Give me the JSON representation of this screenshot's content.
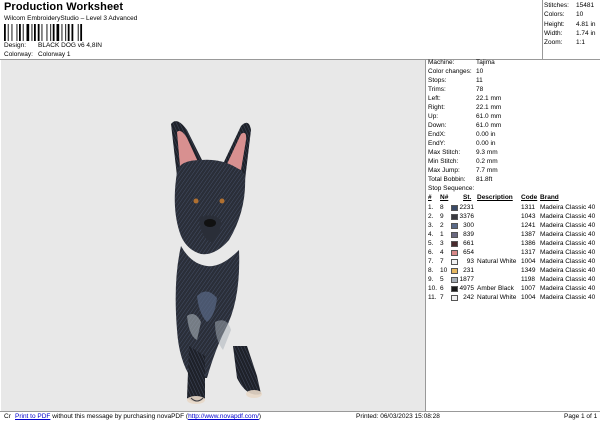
{
  "header": {
    "title": "Production Worksheet",
    "subtitle": "Wilcom EmbroideryStudio – Level 3 Advanced",
    "design_label": "Design:",
    "design_value": "BLACK DOG v6 4,8IN",
    "colorway_label": "Colorway:",
    "colorway_value": "Colorway 1"
  },
  "top_stats": [
    {
      "label": "Stitches:",
      "value": "15481"
    },
    {
      "label": "Colors:",
      "value": "10"
    },
    {
      "label": "Height:",
      "value": "4.81 in"
    },
    {
      "label": "Width:",
      "value": "1.74 in"
    },
    {
      "label": "Zoom:",
      "value": "1:1"
    }
  ],
  "machine_info": [
    {
      "label": "Machine:",
      "value": "Tajima"
    },
    {
      "label": "Color changes:",
      "value": "10"
    },
    {
      "label": "Stops:",
      "value": "11"
    },
    {
      "label": "Trims:",
      "value": "78"
    },
    {
      "label": "Left:",
      "value": "22.1 mm"
    },
    {
      "label": "Right:",
      "value": "22.1 mm"
    },
    {
      "label": "Up:",
      "value": "61.0 mm"
    },
    {
      "label": "Down:",
      "value": "61.0 mm"
    },
    {
      "label": "EndX:",
      "value": "0.00 in"
    },
    {
      "label": "EndY:",
      "value": "0.00 in"
    },
    {
      "label": "Max Stitch:",
      "value": "9.3 mm"
    },
    {
      "label": "Min Stitch:",
      "value": "0.2 mm"
    },
    {
      "label": "Max Jump:",
      "value": "7.7 mm"
    },
    {
      "label": "Total Bobbin:",
      "value": "81.8ft"
    }
  ],
  "stop_sequence": {
    "title": "Stop Sequence:",
    "headers": {
      "num": "#",
      "n": "N#",
      "st": "St.",
      "desc": "Description",
      "code": "Code",
      "brand": "Brand"
    },
    "rows": [
      {
        "num": "1.",
        "n": "8",
        "color": "#3a4a66",
        "st": "2231",
        "desc": "",
        "code": "1311",
        "brand": "Madeira Classic 40"
      },
      {
        "num": "2.",
        "n": "9",
        "color": "#3a3a40",
        "st": "3376",
        "desc": "",
        "code": "1043",
        "brand": "Madeira Classic 40"
      },
      {
        "num": "3.",
        "n": "2",
        "color": "#5a6a88",
        "st": "300",
        "desc": "",
        "code": "1241",
        "brand": "Madeira Classic 40"
      },
      {
        "num": "4.",
        "n": "1",
        "color": "#6a6880",
        "st": "839",
        "desc": "",
        "code": "1387",
        "brand": "Madeira Classic 40"
      },
      {
        "num": "5.",
        "n": "3",
        "color": "#4a2a2e",
        "st": "661",
        "desc": "",
        "code": "1386",
        "brand": "Madeira Classic 40"
      },
      {
        "num": "6.",
        "n": "4",
        "color": "#d88888",
        "st": "654",
        "desc": "",
        "code": "1317",
        "brand": "Madeira Classic 40"
      },
      {
        "num": "7.",
        "n": "7",
        "color": "#f2f2f2",
        "st": "93",
        "desc": "Natural White",
        "code": "1004",
        "brand": "Madeira Classic 40"
      },
      {
        "num": "8.",
        "n": "10",
        "color": "#e6b860",
        "st": "231",
        "desc": "",
        "code": "1349",
        "brand": "Madeira Classic 40"
      },
      {
        "num": "9.",
        "n": "5",
        "color": "#a8b0b8",
        "st": "1877",
        "desc": "",
        "code": "1198",
        "brand": "Madeira Classic 40"
      },
      {
        "num": "10.",
        "n": "6",
        "color": "#1a1a1a",
        "st": "4975",
        "desc": "Amber Black",
        "code": "1007",
        "brand": "Madeira Classic 40"
      },
      {
        "num": "11.",
        "n": "7",
        "color": "#f2f2f2",
        "st": "242",
        "desc": "Natural White",
        "code": "1004",
        "brand": "Madeira Classic 40"
      }
    ]
  },
  "footer": {
    "prefix": "Cr",
    "link1": "Print to PDF",
    "middle": " without this message by purchasing novaPDF (",
    "link2": "http://www.novapdf.com/",
    "suffix": ")",
    "printed": "Printed: 06/03/2023 15:08:28",
    "page": "Page 1 of 1"
  },
  "colors": {
    "canvas_bg": "#e8e8e8",
    "dog_dark": "#23262f",
    "dog_mid": "#3d4658",
    "ear_pink": "#d89090",
    "collar": "#d8b040"
  }
}
